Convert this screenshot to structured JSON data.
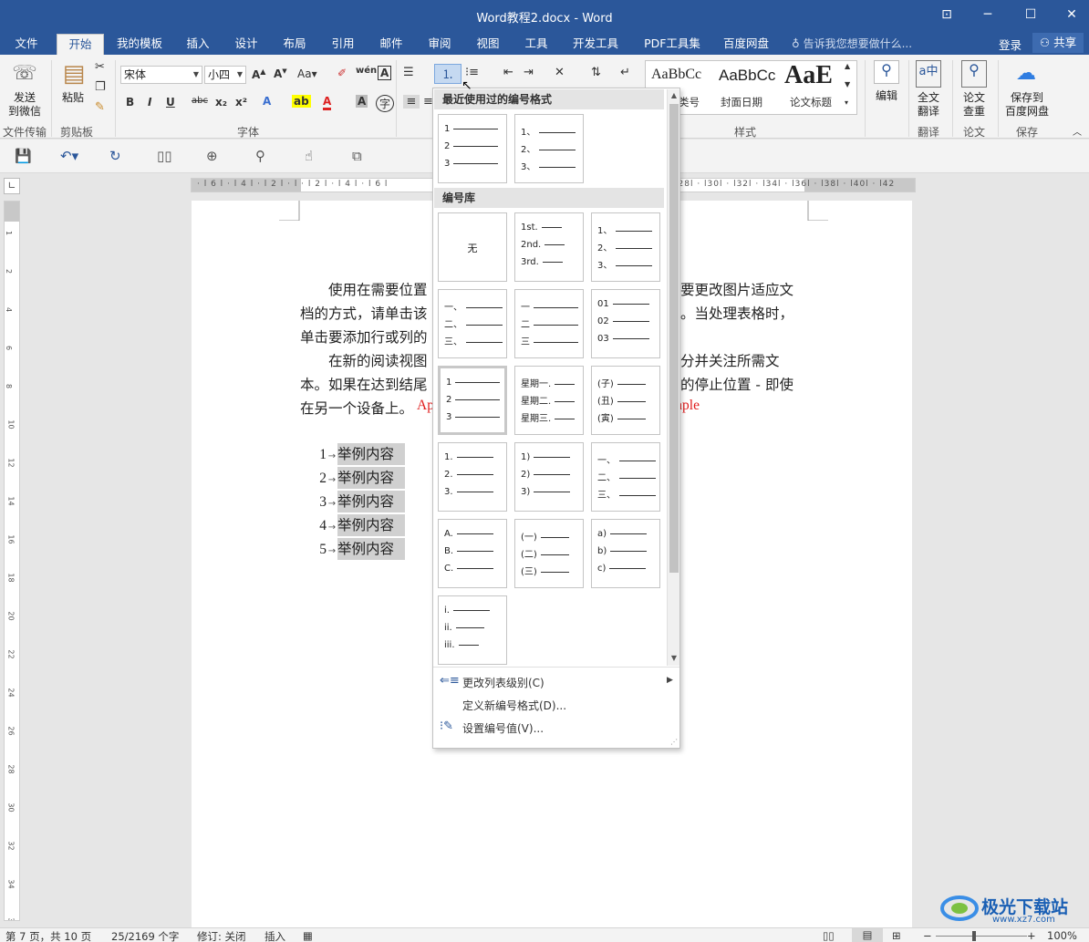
{
  "window": {
    "title": "Word教程2.docx - Word"
  },
  "menu": {
    "tabs": [
      "文件",
      "开始",
      "我的模板",
      "插入",
      "设计",
      "布局",
      "引用",
      "邮件",
      "审阅",
      "视图",
      "工具",
      "开发工具",
      "PDF工具集",
      "百度网盘"
    ],
    "active": "开始",
    "tell_me": "告诉我您想要做什么...",
    "login": "登录",
    "share": "共享"
  },
  "ribbon": {
    "send_wechat": "发送\n到微信",
    "group_file_transfer": "文件传输",
    "paste": "粘贴",
    "group_clipboard": "剪贴板",
    "font_name": "宋体",
    "font_size": "小四",
    "group_font": "字体",
    "group_styles": "样式",
    "style_previews": [
      {
        "preview": "AaBbCc",
        "name": "类号"
      },
      {
        "preview": "AaBbCc",
        "name": "封面日期"
      },
      {
        "preview": "AaE",
        "name": "论文标题"
      }
    ],
    "edit": "编辑",
    "full_translate": "全文\n翻译",
    "group_translate": "翻译",
    "paper_check": "论文\n查重",
    "group_paper": "论文",
    "save_baidu": "保存到\n百度网盘",
    "group_save": "保存"
  },
  "document": {
    "paragraph1_line1_left": "使用在需要位置",
    "paragraph1_line1_right": "要更改图片适应文",
    "paragraph1_line2_left": "档的方式，请单击该",
    "paragraph1_line2_right": "。当处理表格时，",
    "paragraph1_line3_left": "单击要添加行或列的",
    "paragraph2_line1_left": "在新的阅读视图",
    "paragraph2_line1_right": "分并关注所需文",
    "paragraph2_line2_left": "本。如果在达到结尾",
    "paragraph2_line2_right": "的停止位置 - 即使",
    "paragraph2_line3_left": "在另一个设备上。",
    "red_left": "Ap",
    "red_right": "mple",
    "list": [
      {
        "num": "1",
        "text": "举例内容"
      },
      {
        "num": "2",
        "text": "举例内容"
      },
      {
        "num": "3",
        "text": "举例内容"
      },
      {
        "num": "4",
        "text": "举例内容"
      },
      {
        "num": "5",
        "text": "举例内容"
      }
    ]
  },
  "numbering_dropdown": {
    "recent_header": "最近使用过的编号格式",
    "library_header": "编号库",
    "recent": [
      [
        "1",
        "2",
        "3"
      ],
      [
        "1、",
        "2、",
        "3、"
      ]
    ],
    "library": [
      {
        "none": "无"
      },
      {
        "lines": [
          "1st.",
          "2nd.",
          "3rd."
        ]
      },
      {
        "lines": [
          "1、",
          "2、",
          "3、"
        ]
      },
      {
        "lines": [
          "一、",
          "二、",
          "三、"
        ]
      },
      {
        "lines": [
          "一",
          "二",
          "三"
        ]
      },
      {
        "lines": [
          "01",
          "02",
          "03"
        ]
      },
      {
        "lines": [
          "1",
          "2",
          "3"
        ],
        "selected": true
      },
      {
        "lines": [
          "星期一.",
          "星期二.",
          "星期三."
        ]
      },
      {
        "lines": [
          "(子)",
          "(丑)",
          "(寅)"
        ]
      },
      {
        "lines": [
          "1.",
          "2.",
          "3."
        ]
      },
      {
        "lines": [
          "1)",
          "2)",
          "3)"
        ]
      },
      {
        "lines": [
          "一、",
          "二、",
          "三、"
        ]
      },
      {
        "lines": [
          "A.",
          "B.",
          "C."
        ]
      },
      {
        "lines": [
          "(一)",
          "(二)",
          "(三)"
        ]
      },
      {
        "lines": [
          "a)",
          "b)",
          "c)"
        ]
      },
      {
        "lines": [
          "i.",
          "ii.",
          "iii."
        ]
      }
    ],
    "commands": [
      "更改列表级别(C)",
      "定义新编号格式(D)...",
      "设置编号值(V)..."
    ]
  },
  "status_bar": {
    "page": "第 7 页，共 10 页",
    "words": "25/2169 个字",
    "track": "修订: 关闭",
    "mode": "插入",
    "zoom": "100%"
  },
  "watermark": {
    "name": "极光下载站",
    "url": "www.xz7.com"
  },
  "colors": {
    "accent": "#2b579a",
    "red_text": "#e01b1b"
  }
}
